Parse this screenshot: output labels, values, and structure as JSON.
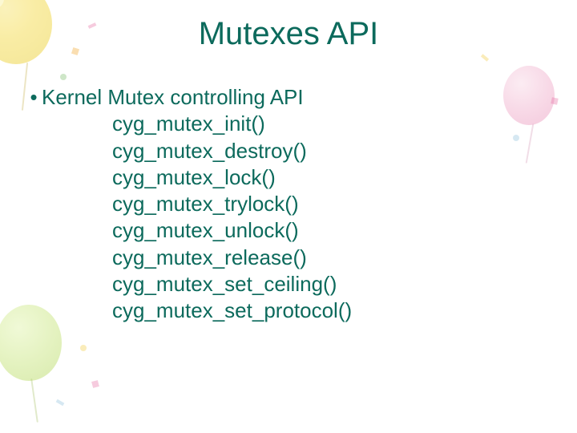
{
  "title": "Mutexes API",
  "bullet_lead": "Kernel Mutex controlling API",
  "api": [
    "cyg_mutex_init()",
    "cyg_mutex_destroy()",
    "cyg_mutex_lock()",
    "cyg_mutex_trylock()",
    "cyg_mutex_unlock()",
    "cyg_mutex_release()",
    "cyg_mutex_set_ceiling()",
    "cyg_mutex_set_protocol()"
  ],
  "bullet_glyph": "•"
}
